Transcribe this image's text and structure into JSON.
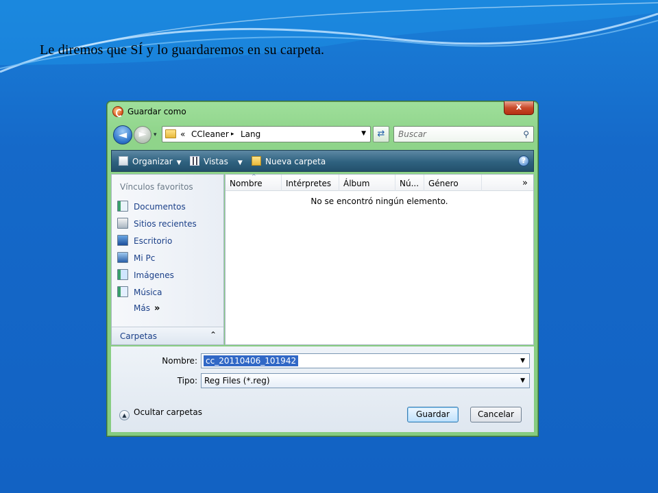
{
  "caption": "Le diremos que SÍ y lo guardaremos en su carpeta.",
  "dialog": {
    "title": "Guardar como",
    "close_label": "x",
    "nav": {
      "back_glyph": "◄",
      "forward_glyph": "►",
      "history_glyph": "▾",
      "breadcrumb_prefix": "«",
      "crumbs": [
        "CCleaner",
        "Lang"
      ],
      "crumb_separator": "▸",
      "refresh_glyph": "⇄",
      "search_placeholder": "Buscar",
      "search_glyph": "⚲"
    },
    "toolbar": {
      "organize_label": "Organizar",
      "views_label": "Vistas",
      "new_folder_label": "Nueva carpeta",
      "dropdown_glyph": "▼",
      "help_glyph": "?"
    },
    "favorites": {
      "title": "Vínculos favoritos",
      "items": [
        {
          "label": "Documentos",
          "icon": "documents-icon"
        },
        {
          "label": "Sitios recientes",
          "icon": "recent-places-icon"
        },
        {
          "label": "Escritorio",
          "icon": "desktop-icon"
        },
        {
          "label": "Mi Pc",
          "icon": "computer-icon"
        },
        {
          "label": "Imágenes",
          "icon": "pictures-icon"
        },
        {
          "label": "Música",
          "icon": "music-icon"
        }
      ],
      "more_label": "Más",
      "more_glyph": "»",
      "folders_label": "Carpetas",
      "folders_glyph": "⌃"
    },
    "file_list": {
      "columns": [
        "Nombre",
        "Intérpretes",
        "Álbum",
        "Nú...",
        "Género"
      ],
      "sort_glyph": "^",
      "more_columns_glyph": "»",
      "empty_message": "No se encontró ningún elemento."
    },
    "save": {
      "name_label": "Nombre:",
      "name_value": "cc_20110406_101942",
      "type_label": "Tipo:",
      "type_value": "Reg Files (*.reg)",
      "dropdown_glyph": "▼",
      "hide_folders_label": "Ocultar carpetas",
      "hide_folders_glyph": "▲",
      "save_button": "Guardar",
      "cancel_button": "Cancelar"
    }
  },
  "colors": {
    "background": "#1565c8",
    "dialog_frame": "#8fd48a",
    "toolbar": "#2f6280",
    "link_text": "#1a3f88",
    "selection": "#3168c6"
  }
}
